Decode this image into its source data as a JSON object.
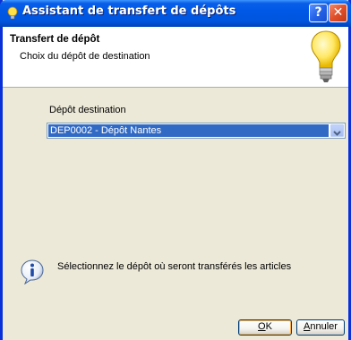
{
  "window": {
    "title": "Assistant de transfert de dépôts",
    "help_label": "?",
    "close_label": "✕"
  },
  "header": {
    "title": "Transfert de dépôt",
    "subtitle": "Choix du dépôt de destination"
  },
  "form": {
    "depot_label": "Dépôt destination",
    "depot_value": "DEP0002 - Dépôt Nantes"
  },
  "info": {
    "text": "Sélectionnez le dépôt où seront transférés les articles"
  },
  "buttons": {
    "ok_mnemonic": "O",
    "ok_rest": "K",
    "cancel_mnemonic": "A",
    "cancel_rest": "nnuler"
  },
  "colors": {
    "titlebar": "#0058e6",
    "selection": "#316ac5",
    "window_bg": "#ece9d8"
  }
}
